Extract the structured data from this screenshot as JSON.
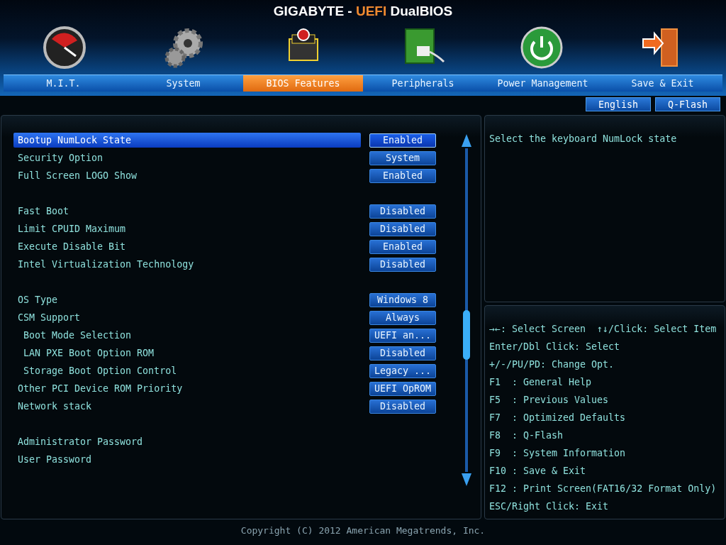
{
  "title": [
    {
      "text": "GIGABYTE - ",
      "kind": "plain"
    },
    {
      "text": "UEFI",
      "kind": "accent"
    },
    {
      "text": " DualBIOS",
      "kind": "plain"
    }
  ],
  "tabs": [
    {
      "label": "M.I.T.",
      "kind": "gauge",
      "selected": false
    },
    {
      "label": "System",
      "kind": "gears",
      "selected": false
    },
    {
      "label": "BIOS Features",
      "kind": "chip",
      "selected": true
    },
    {
      "label": "Peripherals",
      "kind": "board",
      "selected": false
    },
    {
      "label": "Power Management",
      "kind": "power",
      "selected": false
    },
    {
      "label": "Save & Exit",
      "kind": "door",
      "selected": false
    }
  ],
  "top_buttons": [
    "English",
    "Q-Flash"
  ],
  "settings": [
    [
      {
        "label": "Bootup NumLock State",
        "value": "Enabled",
        "indented": false,
        "selected": true
      },
      {
        "label": "Security Option",
        "value": "System",
        "indented": false,
        "selected": false
      },
      {
        "label": "Full Screen LOGO Show",
        "value": "Enabled",
        "indented": false,
        "selected": false
      }
    ],
    [
      {
        "label": "Fast Boot",
        "value": "Disabled",
        "indented": false,
        "selected": false
      },
      {
        "label": "Limit CPUID Maximum",
        "value": "Disabled",
        "indented": false,
        "selected": false
      },
      {
        "label": "Execute Disable Bit",
        "value": "Enabled",
        "indented": false,
        "selected": false
      },
      {
        "label": "Intel Virtualization Technology",
        "value": "Disabled",
        "indented": false,
        "selected": false
      }
    ],
    [
      {
        "label": "OS Type",
        "value": "Windows 8",
        "indented": false,
        "selected": false
      },
      {
        "label": "CSM Support",
        "value": "Always",
        "indented": false,
        "selected": false
      },
      {
        "label": "Boot Mode Selection",
        "value": "UEFI an...",
        "indented": true,
        "selected": false
      },
      {
        "label": "LAN PXE Boot Option ROM",
        "value": "Disabled",
        "indented": true,
        "selected": false
      },
      {
        "label": "Storage Boot Option Control",
        "value": "Legacy ...",
        "indented": true,
        "selected": false
      },
      {
        "label": "Other PCI Device ROM Priority",
        "value": "UEFI OpROM",
        "indented": false,
        "selected": false
      },
      {
        "label": "Network stack",
        "value": "Disabled",
        "indented": false,
        "selected": false
      }
    ],
    [
      {
        "label": "Administrator Password",
        "indented": false,
        "selected": false
      },
      {
        "label": "User Password",
        "indented": false,
        "selected": false
      }
    ]
  ],
  "description": "Select the keyboard NumLock state",
  "key_help": [
    "→←: Select Screen  ↑↓/Click: Select Item",
    "Enter/Dbl Click: Select",
    "+/-/PU/PD: Change Opt.",
    "F1  : General Help",
    "F5  : Previous Values",
    "F7  : Optimized Defaults",
    "F8  : Q-Flash",
    "F9  : System Information",
    "F10 : Save & Exit",
    "F12 : Print Screen(FAT16/32 Format Only)",
    "ESC/Right Click: Exit"
  ],
  "footer": "Copyright (C) 2012 American Megatrends, Inc."
}
